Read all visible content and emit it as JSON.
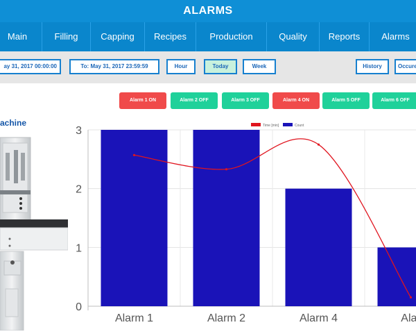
{
  "header": {
    "title": "ALARMS"
  },
  "nav": {
    "items": [
      {
        "label": "Main"
      },
      {
        "label": "Filling"
      },
      {
        "label": "Capping"
      },
      {
        "label": "Recipes"
      },
      {
        "label": "Production"
      },
      {
        "label": "Quality"
      },
      {
        "label": "Reports"
      },
      {
        "label": "Alarms"
      }
    ]
  },
  "filters": {
    "from": "ay 31, 2017 00:00:00",
    "to": "To: May 31, 2017 23:59:59",
    "hour": "Hour",
    "today": "Today",
    "week": "Week",
    "history": "History",
    "occurrences": "Occure"
  },
  "alarms": [
    {
      "label": "Alarm 1 ON",
      "state": "on"
    },
    {
      "label": "Alarm 2 OFF",
      "state": "off"
    },
    {
      "label": "Alarm 3 OFF",
      "state": "off"
    },
    {
      "label": "Alarm 4 ON",
      "state": "on"
    },
    {
      "label": "Alarm 5 OFF",
      "state": "off"
    },
    {
      "label": "Alarm 6 OFF",
      "state": "off"
    }
  ],
  "machine": {
    "title": "achine"
  },
  "colors": {
    "accent": "#0f8fd6",
    "on": "#f04a4a",
    "off": "#1fd19a",
    "bar": "#1a13b8",
    "line": "#e0141e"
  },
  "chart_data": {
    "type": "bar",
    "categories": [
      "Alarm 1",
      "Alarm 2",
      "Alarm 4",
      "Alar"
    ],
    "series": [
      {
        "name": "Count",
        "type": "bar",
        "values": [
          3,
          3,
          2,
          1
        ]
      },
      {
        "name": "Time [min]",
        "type": "line",
        "values": [
          2.57,
          2.33,
          2.75,
          0.15
        ]
      }
    ],
    "yticks": [
      "0",
      "1",
      "2",
      "3"
    ],
    "ylim": [
      0,
      3
    ],
    "legend": "top",
    "grid": true
  }
}
